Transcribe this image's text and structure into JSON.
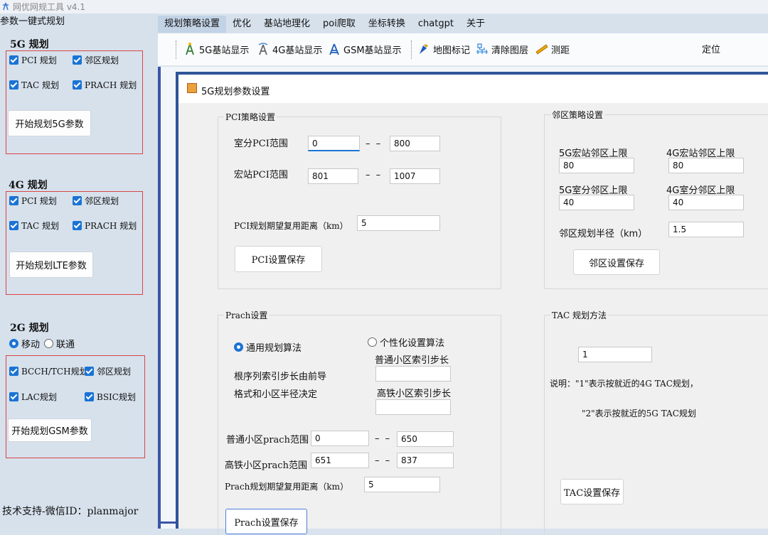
{
  "window": {
    "title": "网优网规工具 v4.1"
  },
  "left": {
    "header": "参数一键式规划",
    "g5": {
      "title": "5G 规划",
      "cbs": [
        "PCI 规划",
        "邻区规划",
        "TAC 规划",
        "PRACH 规划"
      ],
      "button": "开始规划5G参数"
    },
    "g4": {
      "title": "4G 规划",
      "cbs": [
        "PCI 规划",
        "邻区规划",
        "TAC 规划",
        "PRACH 规划"
      ],
      "button": "开始规划LTE参数"
    },
    "g2": {
      "title": "2G 规划",
      "radios": [
        "移动",
        "联通"
      ],
      "cbs": [
        "BCCH/TCH规划",
        "邻区规划",
        "LAC规划",
        "BSIC规划"
      ],
      "button": "开始规划GSM参数"
    },
    "support": "技术支持-微信ID：planmajor"
  },
  "menu": [
    "规划策略设置",
    "优化",
    "基站地理化",
    "poi爬取",
    "坐标转换",
    "chatgpt",
    "关于"
  ],
  "toolbar": {
    "items": [
      "5G基站显示",
      "4G基站显示",
      "GSM基站显示",
      "地图标记",
      "清除图层",
      "测距"
    ],
    "locate": "定位"
  },
  "dialog": {
    "title": "5G规划参数设置",
    "pci": {
      "legend": "PCI策略设置",
      "indoor_label": "室分PCI范围",
      "indoor_from": "0",
      "indoor_to": "800",
      "macro_label": "宏站PCI范围",
      "macro_from": "801",
      "macro_to": "1007",
      "dist_label": "PCI规划期望复用距离（km）",
      "dist": "5",
      "save": "PCI设置保存"
    },
    "nbr": {
      "legend": "邻区策略设置",
      "g5_macro_label": "5G宏站邻区上限",
      "g5_macro": "80",
      "g4_macro_label": "4G宏站邻区上限",
      "g4_macro": "80",
      "g5_indoor_label": "5G室分邻区上限",
      "g5_indoor": "40",
      "g4_indoor_label": "4G室分邻区上限",
      "g4_indoor": "40",
      "radius_label": "邻区规划半径（km）",
      "radius": "1.5",
      "save": "邻区设置保存"
    },
    "prach": {
      "legend": "Prach设置",
      "radio_general": "通用规划算法",
      "radio_custom": "个性化设置算法",
      "normal_step_label": "普通小区索引步长",
      "hsr_step_label": "高铁小区索引步长",
      "desc1": "根序列索引步长由前导",
      "desc2": "格式和小区半径决定",
      "normal_range_label": "普通小区prach范围",
      "normal_from": "0",
      "normal_to": "650",
      "hsr_range_label": "高铁小区prach范围",
      "hsr_from": "651",
      "hsr_to": "837",
      "dist_label": "Prach规划期望复用距离（km）",
      "dist": "5",
      "save": "Prach设置保存"
    },
    "tac": {
      "legend": "TAC 规划方法",
      "value": "1",
      "note1": "说明：\"1\"表示按就近的4G TAC规划，",
      "note2": "\"2\"表示按就近的5G TAC规划",
      "save": "TAC设置保存"
    }
  }
}
